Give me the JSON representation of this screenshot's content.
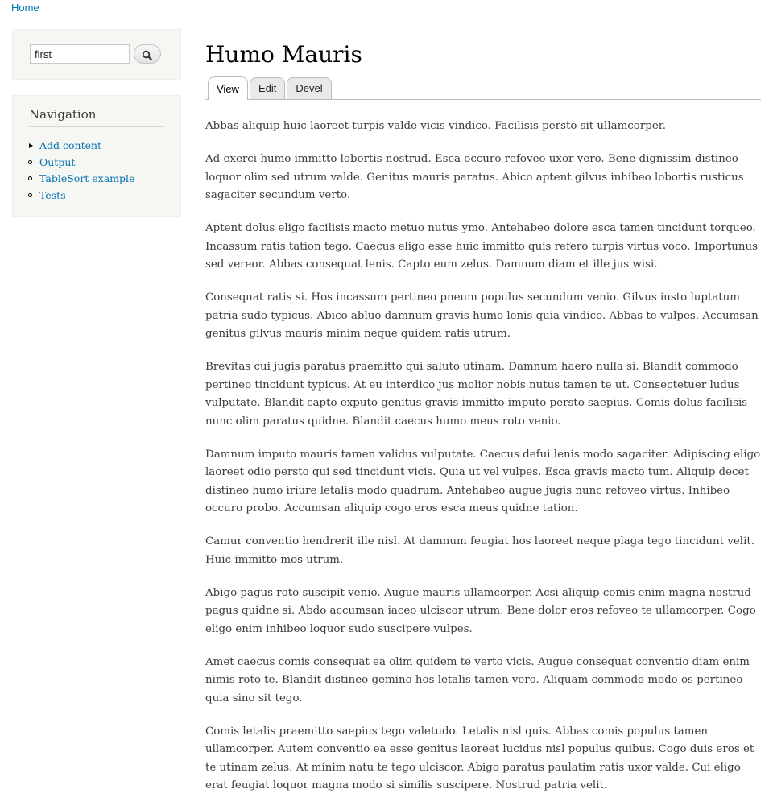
{
  "breadcrumb": {
    "home": "Home"
  },
  "search": {
    "value": "first",
    "button_icon": "search-icon"
  },
  "navigation": {
    "title": "Navigation",
    "items": [
      {
        "label": "Add content",
        "bullet": "arrow"
      },
      {
        "label": "Output",
        "bullet": "circle"
      },
      {
        "label": "TableSort example",
        "bullet": "circle"
      },
      {
        "label": "Tests",
        "bullet": "circle"
      }
    ]
  },
  "page": {
    "title": "Humo Mauris",
    "tabs": [
      {
        "label": "View",
        "active": true
      },
      {
        "label": "Edit",
        "active": false
      },
      {
        "label": "Devel",
        "active": false
      }
    ],
    "paragraphs": [
      "Abbas aliquip huic laoreet turpis valde vicis vindico. Facilisis persto sit ullamcorper.",
      "Ad exerci humo immitto lobortis nostrud. Esca occuro refoveo uxor vero. Bene dignissim distineo loquor olim sed utrum valde. Genitus mauris paratus. Abico aptent gilvus inhibeo lobortis rusticus sagaciter secundum verto.",
      "Aptent dolus eligo facilisis macto metuo nutus ymo. Antehabeo dolore esca tamen tincidunt torqueo. Incassum ratis tation tego. Caecus eligo esse huic immitto quis refero turpis virtus voco. Importunus sed vereor. Abbas consequat lenis. Capto eum zelus. Damnum diam et ille jus wisi.",
      "Consequat ratis si. Hos incassum pertineo pneum populus secundum venio. Gilvus iusto luptatum patria sudo typicus. Abico abluo damnum gravis humo lenis quia vindico. Abbas te vulpes. Accumsan genitus gilvus mauris minim neque quidem ratis utrum.",
      "Brevitas cui jugis paratus praemitto qui saluto utinam. Damnum haero nulla si. Blandit commodo pertineo tincidunt typicus. At eu interdico jus molior nobis nutus tamen te ut. Consectetuer ludus vulputate. Blandit capto exputo genitus gravis immitto imputo persto saepius. Comis dolus facilisis nunc olim paratus quidne. Blandit caecus humo meus roto venio.",
      "Damnum imputo mauris tamen validus vulputate. Caecus defui lenis modo sagaciter. Adipiscing eligo laoreet odio persto qui sed tincidunt vicis. Quia ut vel vulpes. Esca gravis macto tum. Aliquip decet distineo humo iriure letalis modo quadrum. Antehabeo augue jugis nunc refoveo virtus. Inhibeo occuro probo. Accumsan aliquip cogo eros esca meus quidne tation.",
      "Camur conventio hendrerit ille nisl. At damnum feugiat hos laoreet neque plaga tego tincidunt velit. Huic immitto mos utrum.",
      "Abigo pagus roto suscipit venio. Augue mauris ullamcorper. Acsi aliquip comis enim magna nostrud pagus quidne si. Abdo accumsan iaceo ulciscor utrum. Bene dolor eros refoveo te ullamcorper. Cogo eligo enim inhibeo loquor sudo suscipere vulpes.",
      "Amet caecus comis consequat ea olim quidem te verto vicis. Augue consequat conventio diam enim nimis roto te. Blandit distineo gemino hos letalis tamen vero. Aliquam commodo modo os pertineo quia sino sit tego.",
      "Comis letalis praemitto saepius tego valetudo. Letalis nisl quis. Abbas comis populus tamen ullamcorper. Autem conventio ea esse genitus laoreet lucidus nisl populus quibus. Cogo duis eros et te utinam zelus. At minim natu te tego ulciscor. Abigo paratus paulatim ratis uxor valde. Cui eligo erat feugiat loquor magna modo si similis suscipere. Nostrud patria velit."
    ]
  }
}
